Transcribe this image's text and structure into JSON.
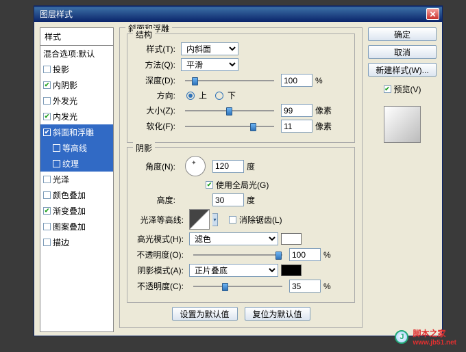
{
  "window": {
    "title": "图层样式"
  },
  "sidebar": {
    "title": "样式",
    "items": [
      {
        "label": "混合选项:默认",
        "checked": null
      },
      {
        "label": "投影",
        "checked": false
      },
      {
        "label": "内阴影",
        "checked": true
      },
      {
        "label": "外发光",
        "checked": false
      },
      {
        "label": "内发光",
        "checked": true
      },
      {
        "label": "斜面和浮雕",
        "checked": true
      },
      {
        "label": "等高线",
        "checked": false
      },
      {
        "label": "纹理",
        "checked": false
      },
      {
        "label": "光泽",
        "checked": false
      },
      {
        "label": "颜色叠加",
        "checked": false
      },
      {
        "label": "渐变叠加",
        "checked": true
      },
      {
        "label": "图案叠加",
        "checked": false
      },
      {
        "label": "描边",
        "checked": false
      }
    ]
  },
  "group1": {
    "title": "斜面和浮雕"
  },
  "structure": {
    "title": "结构",
    "style_label": "样式(T):",
    "style_value": "内斜面",
    "technique_label": "方法(Q):",
    "technique_value": "平滑",
    "depth_label": "深度(D):",
    "depth_value": "100",
    "depth_unit": "%",
    "direction_label": "方向:",
    "up": "上",
    "down": "下",
    "size_label": "大小(Z):",
    "size_value": "99",
    "size_unit": "像素",
    "soften_label": "软化(F):",
    "soften_value": "11",
    "soften_unit": "像素"
  },
  "shading": {
    "title": "阴影",
    "angle_label": "角度(N):",
    "angle_value": "120",
    "angle_unit": "度",
    "global": "使用全局光(G)",
    "altitude_label": "高度:",
    "altitude_value": "30",
    "altitude_unit": "度",
    "gloss_label": "光泽等高线:",
    "antialias": "消除锯齿(L)",
    "highlight_label": "高光模式(H):",
    "highlight_value": "滤色",
    "h_opacity_label": "不透明度(O):",
    "h_opacity_value": "100",
    "h_opacity_unit": "%",
    "shadow_label": "阴影模式(A):",
    "shadow_value": "正片叠底",
    "s_opacity_label": "不透明度(C):",
    "s_opacity_value": "35",
    "s_opacity_unit": "%"
  },
  "bottom": {
    "default": "设置为默认值",
    "reset": "复位为默认值"
  },
  "right": {
    "ok": "确定",
    "cancel": "取消",
    "newstyle": "新建样式(W)...",
    "preview": "预览(V)"
  },
  "watermark": {
    "text": "脚本之家",
    "url": "www.jb51.net",
    "logo": "J"
  }
}
